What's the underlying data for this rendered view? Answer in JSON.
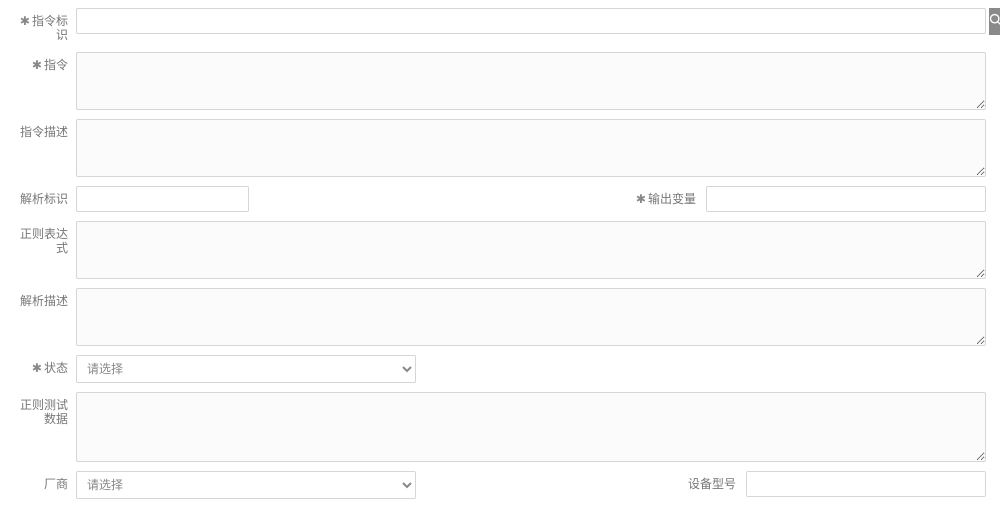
{
  "labels": {
    "cmdId": "指令标识",
    "cmd": "指令",
    "cmdDesc": "指令描述",
    "parseId": "解析标识",
    "outputVar": "输出变量",
    "regex": "正则表达式",
    "parseDesc": "解析描述",
    "status": "状态",
    "regexTest": "正则测试数据",
    "vendor": "厂商",
    "deviceModel": "设备型号"
  },
  "values": {
    "cmdId": "",
    "cmd": "",
    "cmdDesc": "",
    "parseId": "",
    "outputVar": "",
    "regex": "",
    "parseDesc": "",
    "regexTest": "",
    "deviceModel": ""
  },
  "selects": {
    "placeholder": "请选择"
  },
  "icons": {
    "search": "search-icon",
    "info": "info-icon"
  },
  "req": "✱"
}
